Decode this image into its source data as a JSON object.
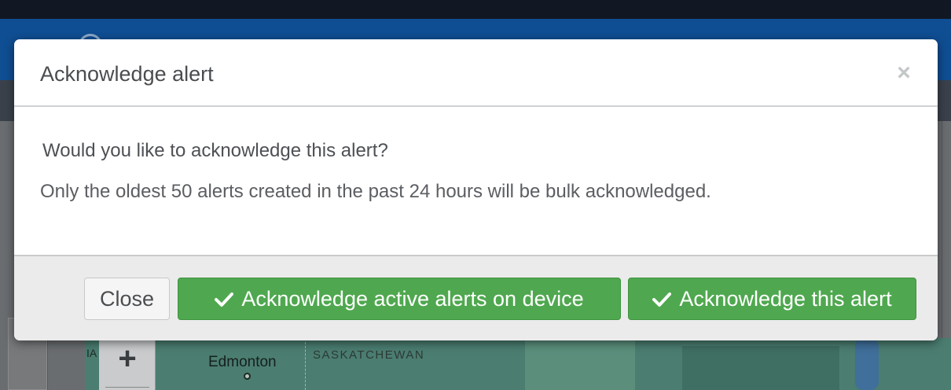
{
  "background": {
    "map_labels": {
      "partial": "IA",
      "city": "Edmonton",
      "region": "SASKATCHEWAN"
    },
    "zoom_in_glyph": "+"
  },
  "modal": {
    "title": "Acknowledge alert",
    "close_glyph": "×",
    "question": "Would you like to acknowledge this alert?",
    "note": "Only the oldest 50 alerts created in the past 24 hours will be bulk acknowledged.",
    "buttons": {
      "close": "Close",
      "ack_device": "Acknowledge active alerts on device",
      "ack_this": "Acknowledge this alert"
    }
  },
  "colors": {
    "primary_green": "#4fa84f",
    "header_blue": "#0f4e93",
    "top_dark": "#111823"
  },
  "icons": {
    "button_icon": "check-icon",
    "dismiss_icon": "close-icon"
  }
}
